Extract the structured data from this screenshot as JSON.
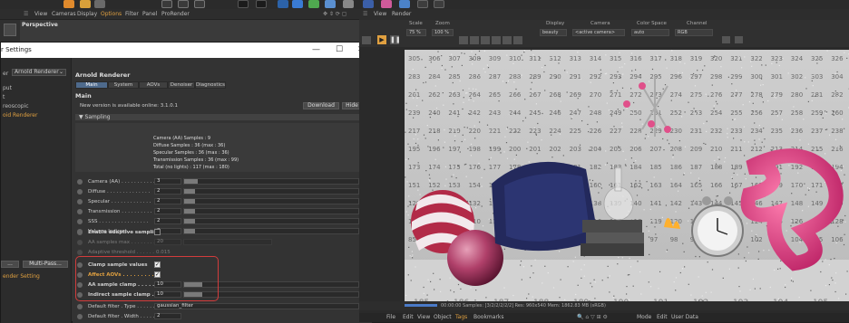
{
  "viewport": {
    "menu": [
      "View",
      "Cameras",
      "Display",
      "Options",
      "Filter",
      "Panel",
      "ProRender"
    ],
    "active_menu": "Options",
    "title": "Perspective"
  },
  "render_settings": {
    "title": "r Settings",
    "window_controls": [
      "—",
      "☐",
      "✕"
    ],
    "renderer_label": "er",
    "renderer_value": "Arnold Renderer",
    "left_items": [
      "put",
      "t",
      "reoscopic",
      "oid Renderer"
    ],
    "left_highlight": "oid Renderer",
    "left_buttons": [
      "...",
      "Multi-Pass..."
    ],
    "left_bottom": "ender Setting",
    "header": "Arnold Renderer",
    "tabs": [
      "Main",
      "System",
      "AOVs",
      "Denoiser",
      "Diagnostics"
    ],
    "active_tab": "Main",
    "section_main": "Main",
    "version_notice": "New version is available online: 3.1.0.1",
    "download_btn": "Download",
    "hide_btn": "Hide",
    "sampling_section": "▼ Sampling",
    "info_lines": [
      "Camera (AA) Samples : 9",
      "Diffuse Samples : 36 (max : 36)",
      "Specular Samples : 36 (max : 36)",
      "Transmission Samples : 36 (max : 99)",
      "Total (no lights) : 117 (max : 180)"
    ],
    "params": [
      {
        "label": "Camera (AA) . . . . . . . . . . .",
        "value": "3",
        "fill": 0.08
      },
      {
        "label": "Diffuse . . . . . . . . . . . . . .",
        "value": "2",
        "fill": 0.06
      },
      {
        "label": "Specular . . . . . . . . . . . . .",
        "value": "2",
        "fill": 0.06
      },
      {
        "label": "Transmission . . . . . . . . . .",
        "value": "2",
        "fill": 0.06
      },
      {
        "label": "SSS . . . . . . . . . . . . . . . .",
        "value": "2",
        "fill": 0.06
      },
      {
        "label": "Volume Indirect . . . . . . . .",
        "value": "2",
        "fill": 0.06
      }
    ],
    "adaptive_label": "Enable adaptive sampling",
    "aa_max_label": "AA samples max . . . . . . . .",
    "aa_max_value": "20",
    "adaptive_threshold_label": "Adaptive threshold . . . . . .",
    "adaptive_threshold_value": "0.015",
    "clamp_label": "Clamp sample values",
    "affect_label": "Affect AOVs . . . . . . . . . . .",
    "aa_clamp_label": "AA sample clamp . . . . . . . .",
    "aa_clamp_value": "10",
    "indirect_clamp_label": "Indirect sample clamp . . . . .",
    "indirect_clamp_value": "10",
    "filter_type_label": "Default filter . Type . . . . . .",
    "filter_type_value": "gaussian_filter",
    "filter_width_label": "Default filter . Width . . . . .",
    "filter_width_value": "2",
    "accent_red": "#d23c3c",
    "orange_text": "#e0a040"
  },
  "render_view": {
    "menu": [
      "View",
      "Render"
    ],
    "scale_label": "Scale",
    "scale_value": "75 %",
    "zoom_label": "Zoom",
    "zoom_value": "100 %",
    "display_label": "Display",
    "display_value": "beauty",
    "camera_label": "Camera",
    "camera_value": "<active camera>",
    "colorspace_label": "Color Space",
    "colorspace_value": "auto",
    "channel_label": "Channel",
    "channel_value": "RGB",
    "status": "00:00:00   Samples: [3/2/2/2/2/2]   Res: 960x540   Mem: 1862.83 MB   (sRGB)",
    "bottom_menu": [
      "File",
      "Edit",
      "View",
      "Object",
      "Tags",
      "Bookmarks"
    ],
    "bottom_right": [
      "Mode",
      "Edit",
      "User Data"
    ],
    "calendar_numbers": [
      "305",
      "306",
      "307",
      "308",
      "309",
      "310",
      "311",
      "312",
      "313",
      "314",
      "315",
      "316",
      "317",
      "318",
      "319",
      "320",
      "321",
      "322",
      "323",
      "324",
      "325",
      "326"
    ]
  }
}
